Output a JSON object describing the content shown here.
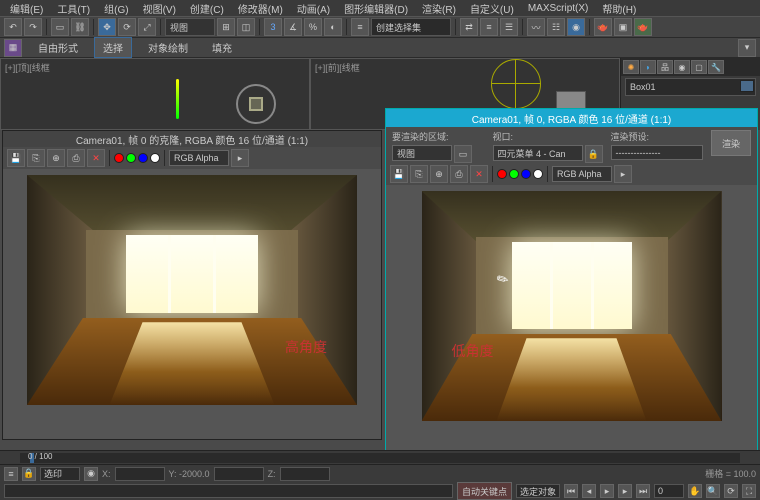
{
  "menu": {
    "items": [
      "编辑(E)",
      "工具(T)",
      "组(G)",
      "视图(V)",
      "创建(C)",
      "修改器(M)",
      "动画(A)",
      "图形编辑器(D)",
      "渲染(R)",
      "自定义(U)",
      "MAXScript(X)",
      "帮助(H)"
    ]
  },
  "toolbar": {
    "viewport_drop": "视图",
    "set_drop": "创建选择集"
  },
  "tabs": {
    "shape": "自由形式",
    "select": "选择",
    "draw": "对象绘制",
    "fill": "填充"
  },
  "viewport": {
    "left_label": "[+][顶][线框",
    "right_label": "[+][前][线框"
  },
  "render1": {
    "title": "Camera01, 帧 0 的克隆, RGBA 颜色 16 位/通道 (1:1)",
    "channel": "RGB Alpha",
    "overlay": "高角度"
  },
  "render2": {
    "title": "Camera01, 帧 0, RGBA 颜色 16 位/通道 (1:1)",
    "area_label": "要渲染的区域:",
    "area_drop": "视图",
    "viewport_label": "视口:",
    "viewport_drop": "四元菜单 4 - Can",
    "preset_label": "渲染预设:",
    "preset_drop": "---------------",
    "render_btn": "渲染",
    "channel": "RGB Alpha",
    "overlay": "低角度"
  },
  "side": {
    "object": "Box01"
  },
  "timeline": {
    "range": "0 / 100"
  },
  "status": {
    "sel": "选印",
    "x": "X:",
    "xval": "",
    "y": "Y: -2000.0",
    "z": "Z:",
    "grid": "栅格 = 100.0",
    "autokey": "自动关键点",
    "selset": "选定对象"
  }
}
